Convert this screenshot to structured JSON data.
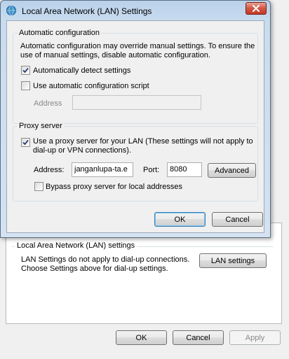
{
  "dialog": {
    "title": "Local Area Network (LAN) Settings",
    "auto_config": {
      "group_title": "Automatic configuration",
      "description": "Automatic configuration may override manual settings.  To ensure the use of manual settings, disable automatic configuration.",
      "auto_detect_label": "Automatically detect settings",
      "auto_detect_checked": true,
      "use_script_label": "Use automatic configuration script",
      "use_script_checked": false,
      "address_label": "Address",
      "address_value": ""
    },
    "proxy": {
      "group_title": "Proxy server",
      "use_proxy_label": "Use a proxy server for your LAN (These settings will not apply to dial-up or VPN connections).",
      "use_proxy_checked": true,
      "address_label": "Address:",
      "address_value": "janganlupa-ta.e",
      "port_label": "Port:",
      "port_value": "8080",
      "advanced_label": "Advanced",
      "bypass_label": "Bypass proxy server for local addresses",
      "bypass_checked": false
    },
    "ok_label": "OK",
    "cancel_label": "Cancel"
  },
  "background": {
    "lan_group_title": "Local Area Network (LAN) settings",
    "lan_text": "LAN Settings do not apply to dial-up connections. Choose Settings above for dial-up settings.",
    "lan_settings_label": "LAN settings",
    "ok_label": "OK",
    "cancel_label": "Cancel",
    "apply_label": "Apply"
  }
}
